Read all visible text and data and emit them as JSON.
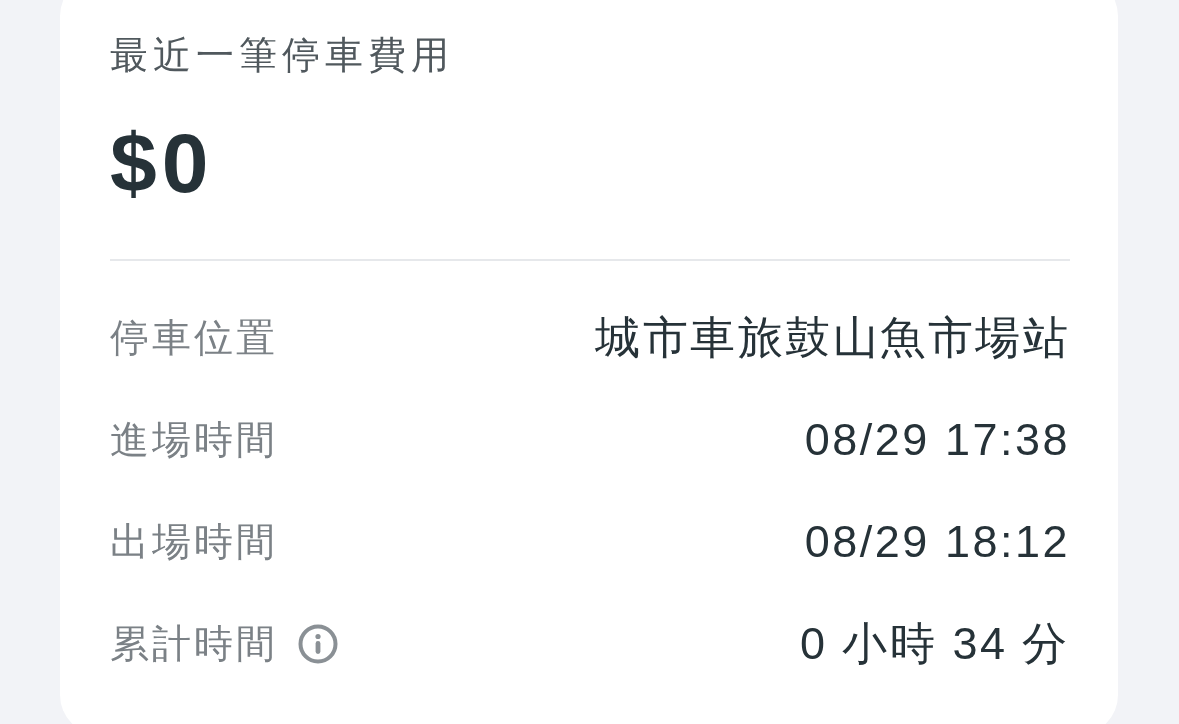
{
  "card": {
    "title": "最近一筆停車費用",
    "amount": "$0",
    "details": [
      {
        "label": "停車位置",
        "value": "城市車旅鼓山魚市場站",
        "info": false
      },
      {
        "label": "進場時間",
        "value": "08/29 17:38",
        "info": false
      },
      {
        "label": "出場時間",
        "value": "08/29 18:12",
        "info": false
      },
      {
        "label": "累計時間",
        "value": "0 小時 34 分",
        "info": true
      }
    ]
  }
}
